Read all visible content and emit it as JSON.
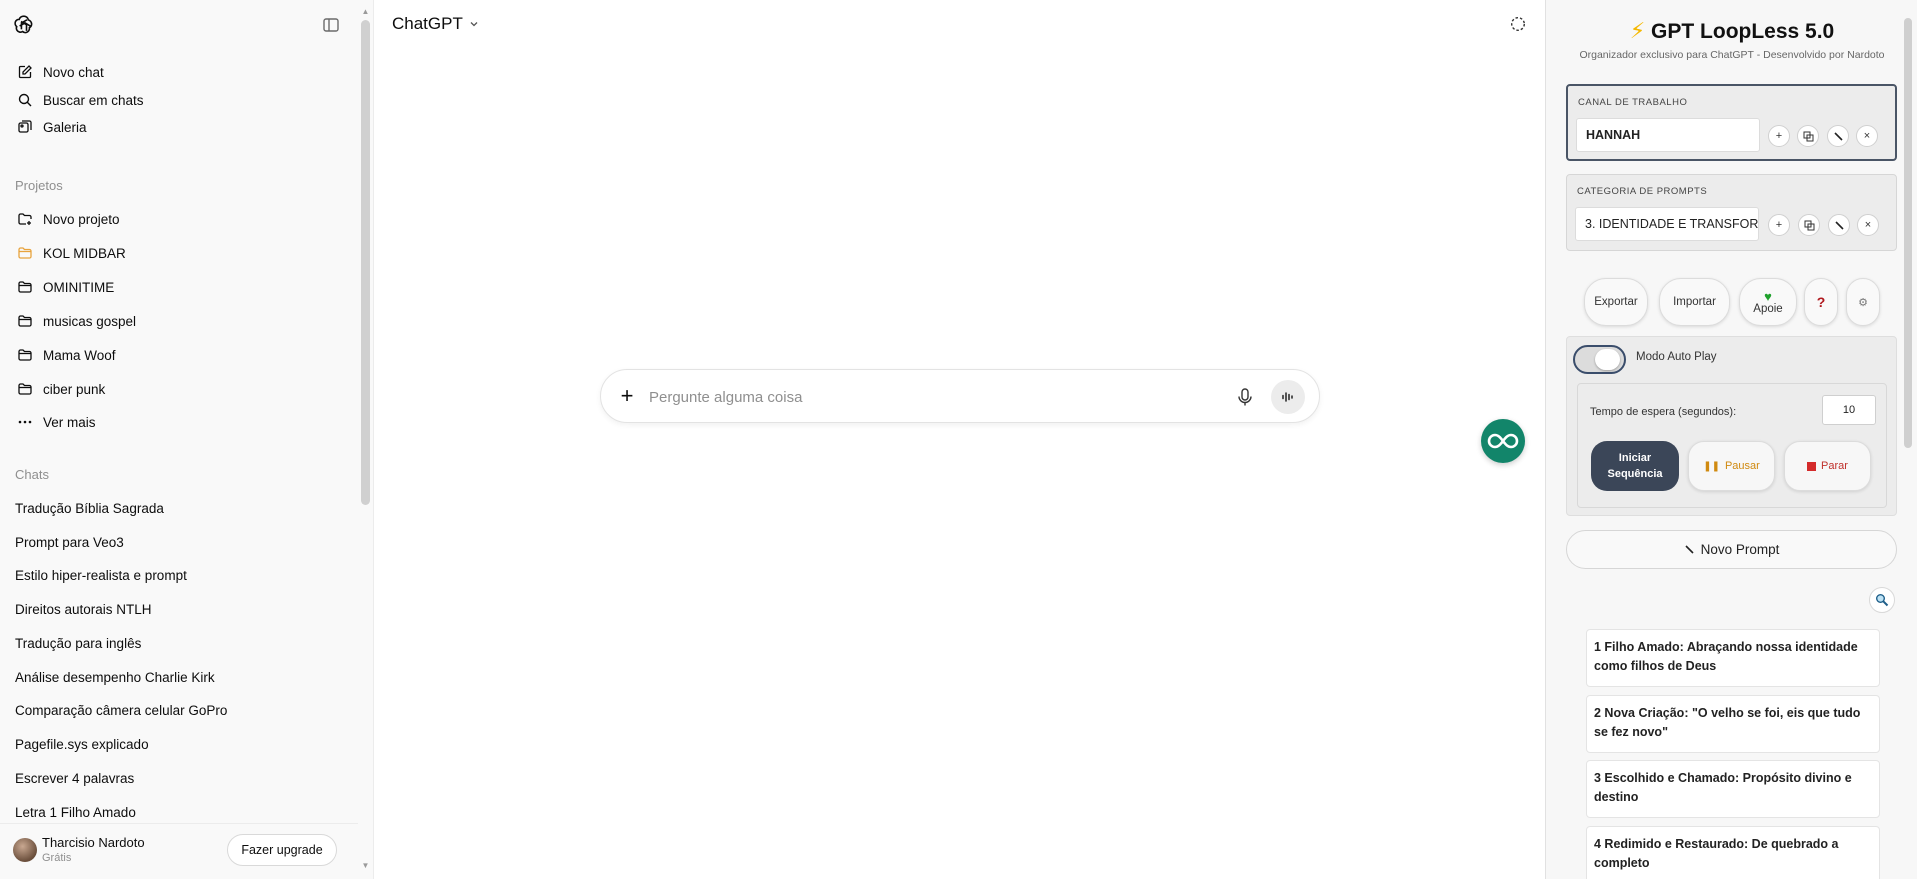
{
  "sidebar": {
    "nav": [
      {
        "label": "Novo chat",
        "icon": "edit-icon"
      },
      {
        "label": "Buscar em chats",
        "icon": "search-icon"
      },
      {
        "label": "Galeria",
        "icon": "gallery-icon"
      }
    ],
    "projects_label": "Projetos",
    "projects": [
      {
        "label": "Novo projeto",
        "icon": "new-folder-icon"
      },
      {
        "label": "KOL MIDBAR",
        "icon": "folder-icon",
        "color": "#e8a33d"
      },
      {
        "label": "OMINITIME",
        "icon": "folder-icon"
      },
      {
        "label": "musicas gospel",
        "icon": "folder-icon"
      },
      {
        "label": "Mama Woof",
        "icon": "folder-icon"
      },
      {
        "label": "ciber punk",
        "icon": "folder-icon"
      },
      {
        "label": "Ver mais",
        "icon": "more-dots-icon"
      }
    ],
    "chats_label": "Chats",
    "chats": [
      "Tradução Bíblia Sagrada",
      "Prompt para Veo3",
      "Estilo hiper-realista e prompt",
      "Direitos autorais NTLH",
      "Tradução para inglês",
      "Análise desempenho Charlie Kirk",
      "Comparação câmera celular GoPro",
      "Pagefile.sys explicado",
      "Escrever 4 palavras",
      "Letra 1 Filho Amado"
    ],
    "user": {
      "name": "Tharcisio Nardoto",
      "plan": "Grátis"
    },
    "upgrade_label": "Fazer upgrade"
  },
  "main": {
    "model_name": "ChatGPT",
    "composer": {
      "placeholder": "Pergunte alguma coisa",
      "plus_label": "+"
    }
  },
  "panel": {
    "title": "GPT LoopLess 5.0",
    "subtitle": "Organizador exclusivo para ChatGPT - Desenvolvido por Nardoto",
    "channel": {
      "label": "CANAL DE TRABALHO",
      "value": "HANNAH"
    },
    "category": {
      "label": "CATEGORIA DE PROMPTS",
      "value": "3. IDENTIDADE E TRANSFOR..."
    },
    "mini_buttons": {
      "add": "+",
      "remove": "×"
    },
    "actions": {
      "export": "Exportar",
      "import": "Importar",
      "support": "Apoie"
    },
    "autoplay": {
      "label": "Modo Auto Play",
      "enabled": false,
      "wait_label": "Tempo de espera (segundos):",
      "wait_value": "10",
      "start_line1": "Iniciar",
      "start_line2": "Sequência",
      "pause": "Pausar",
      "stop": "Parar"
    },
    "new_prompt": "Novo Prompt",
    "prompts": [
      "1 Filho Amado: Abraçando nossa identidade como filhos de Deus",
      "2 Nova Criação: \"O velho se foi, eis que tudo se fez novo\"",
      "3 Escolhido e Chamado: Propósito divino e destino",
      "4 Redimido e Restaurado: De quebrado a completo"
    ],
    "colors": {
      "accent": "#3b4658",
      "float_button": "#12856a",
      "bolt": "#f5b800"
    }
  }
}
